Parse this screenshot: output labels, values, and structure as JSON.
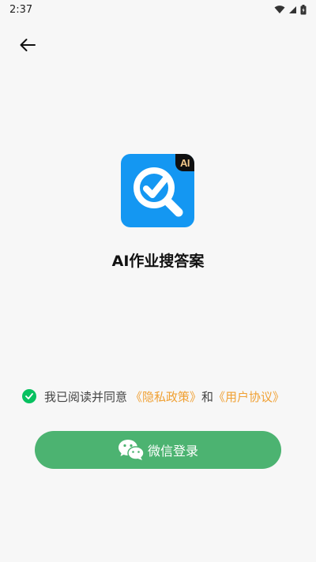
{
  "status_bar": {
    "time": "2:37",
    "icons": [
      "wifi-icon",
      "cellular-icon",
      "battery-icon"
    ]
  },
  "header": {
    "back_icon": "arrow-left-icon"
  },
  "app": {
    "logo_badge": "AI",
    "name": "AI作业搜答案"
  },
  "agreement": {
    "checked": true,
    "prefix": "我已阅读并同意",
    "privacy_link": "《隐私政策》",
    "conjunction": "和",
    "terms_link": "《用户协议》"
  },
  "login": {
    "icon": "wechat-icon",
    "label": "微信登录"
  },
  "colors": {
    "background": "#f7f7f7",
    "logo_blue": "#1497f2",
    "checkbox_green": "#07c160",
    "link_orange": "#f0a033",
    "button_green": "#4cb371"
  }
}
